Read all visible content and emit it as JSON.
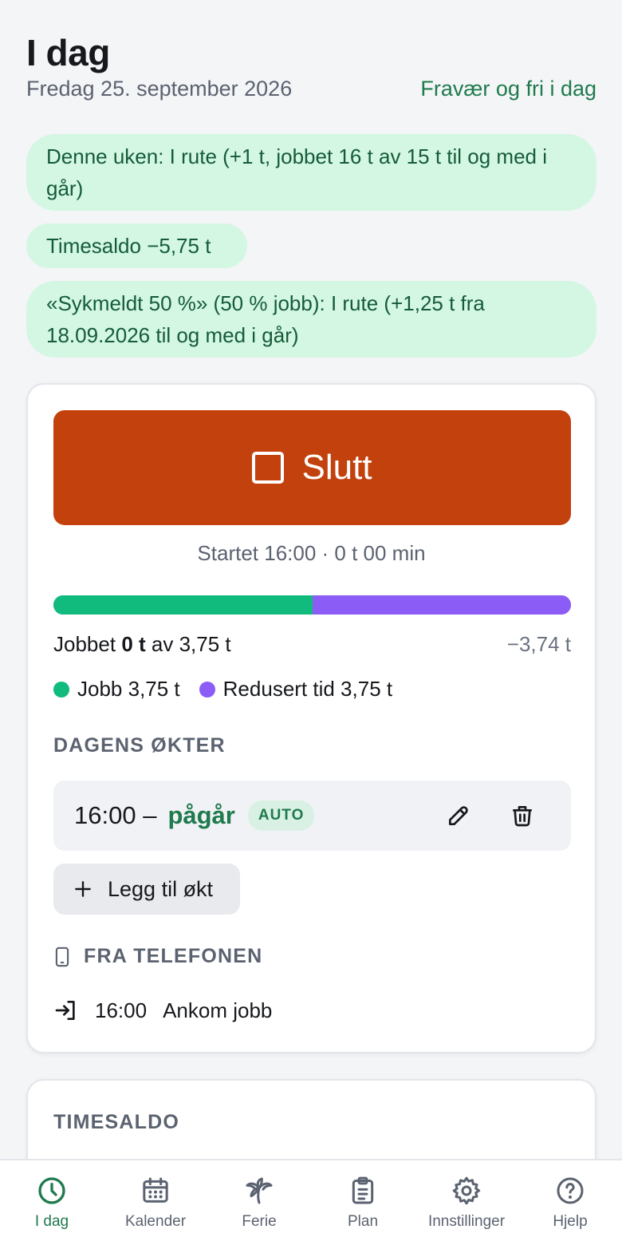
{
  "header": {
    "title": "I dag",
    "date": "Fredag 25. september 2026",
    "absence_link": "Fravær og fri i dag"
  },
  "status_pills": {
    "week": "Denne uken: I rute (+1 t, jobbet 16 t av 15 t til og med i går)",
    "balance": "Timesaldo −5,75 t",
    "sick_leave": "«Sykmeldt 50 %» (50 % jobb): I rute (+1,25 t fra 18.09.2026 til og med i går)"
  },
  "timer": {
    "stop_label": "Slutt",
    "started_text": "Startet 16:00 · 0 t 00 min"
  },
  "progress": {
    "job_fraction": 0.5,
    "reduced_fraction": 0.5,
    "worked_prefix": "Jobbet",
    "worked_value": "0 t",
    "worked_suffix": "av 3,75 t",
    "difference": "−3,74 t",
    "legend": [
      {
        "label": "Jobb 3,75 t",
        "color": "#10bb7d"
      },
      {
        "label": "Redusert tid 3,75 t",
        "color": "#8b5cf6"
      }
    ]
  },
  "sessions": {
    "label": "DAGENS ØKTER",
    "items": [
      {
        "start": "16:00 –",
        "status": "pågår",
        "badge": "AUTO"
      }
    ],
    "add_label": "Legg til økt"
  },
  "phone": {
    "label": "FRA TELEFONEN",
    "events": [
      {
        "time": "16:00",
        "text": "Ankom jobb"
      }
    ]
  },
  "balance_card": {
    "label": "TIMESALDO"
  },
  "nav": {
    "items": [
      {
        "label": "I dag",
        "icon": "clock-icon",
        "active": true
      },
      {
        "label": "Kalender",
        "icon": "calendar-icon"
      },
      {
        "label": "Ferie",
        "icon": "palm-tree-icon"
      },
      {
        "label": "Plan",
        "icon": "clipboard-icon"
      },
      {
        "label": "Innstillinger",
        "icon": "gear-icon"
      },
      {
        "label": "Hjelp",
        "icon": "help-circle-icon"
      }
    ]
  },
  "colors": {
    "accent_green": "#1f7a4d",
    "stop_button": "#c2410c",
    "pill_bg": "#d3f7e2",
    "job_green": "#10bb7d",
    "reduced_purple": "#8b5cf6"
  }
}
